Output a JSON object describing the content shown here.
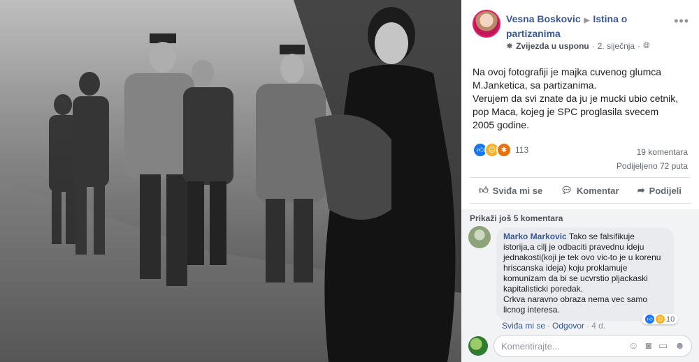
{
  "post": {
    "author": "Vesna Boskovic",
    "group": "Istina o partizanima",
    "badge": "Zvijezda u usponu",
    "date": "2. siječnja",
    "text_lines": [
      "Na ovoj fotografiji je majka cuvenog glumca M.Janketica, sa partizanima.",
      "Verujem da svi znate da ju je mucki ubio cetnik, pop Maca, kojeg je SPC proglasila svecem 2005 godine."
    ],
    "reactions_count": "113",
    "comments_count": "19 komentara",
    "shares_count": "Podijeljeno 72 puta"
  },
  "actions": {
    "like": "Sviđa mi se",
    "comment": "Komentar",
    "share": "Podijeli"
  },
  "comments": {
    "show_more": "Prikaži još 5 komentara",
    "items": [
      {
        "author": "Marko Markovic",
        "text_lines": [
          "Tako se falsifikuje istorija,a cilj je odbaciti pravednu ideju jednakosti(koji je tek ovo vic-to je u korenu hriscanska ideja) koju proklamuje komunizam da bi se ucvrstio pljackaski kapitalisticki poredak.",
          "Crkva naravno obraza nema vec samo licnog interesa."
        ],
        "reactions": "10",
        "like_label": "Sviđa mi se",
        "reply_label": "Odgovor",
        "time": "4 d."
      }
    ],
    "write_placeholder": "Komentirajte..."
  },
  "icons": {
    "globe": "globe-icon",
    "like": "thumbs-up-icon",
    "comment": "speech-bubble-icon",
    "share": "share-arrow-icon",
    "emoji": "emoji-icon",
    "camera": "camera-icon",
    "gif": "gif-icon",
    "sticker": "sticker-icon",
    "more": "more-dots-icon"
  },
  "colors": {
    "link": "#385898",
    "panel_bg": "#ffffff",
    "comment_bg": "#f2f3f5",
    "like_blue": "#1877f2",
    "sad_yellow": "#f7b125",
    "angry_orange": "#e9710f"
  }
}
